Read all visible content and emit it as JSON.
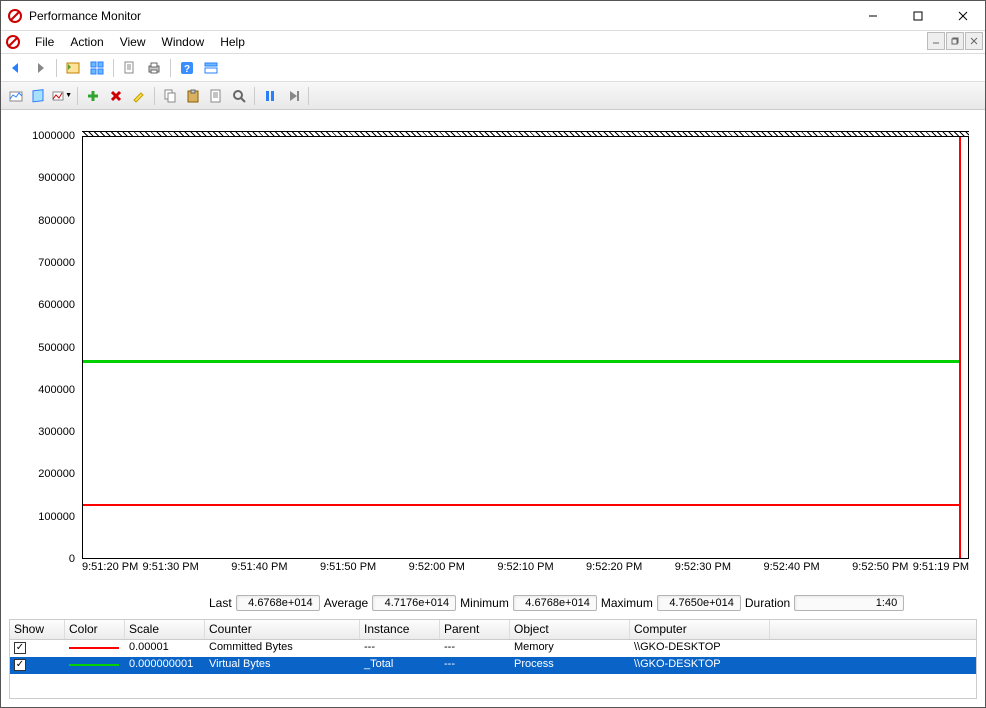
{
  "window": {
    "title": "Performance Monitor"
  },
  "menu": {
    "file": "File",
    "action": "Action",
    "view": "View",
    "window": "Window",
    "help": "Help"
  },
  "chart_data": {
    "type": "line",
    "title": "",
    "xlabel": "",
    "ylabel": "",
    "ylim": [
      0,
      1000000
    ],
    "yticks": [
      0,
      100000,
      200000,
      300000,
      400000,
      500000,
      600000,
      700000,
      800000,
      900000,
      1000000
    ],
    "xticks": [
      "9:51:20 PM",
      "9:51:30 PM",
      "9:51:40 PM",
      "9:51:50 PM",
      "9:52:00 PM",
      "9:52:10 PM",
      "9:52:20 PM",
      "9:52:30 PM",
      "9:52:40 PM",
      "9:52:50 PM",
      "9:51:19 PM"
    ],
    "series": [
      {
        "name": "Committed Bytes",
        "color": "#ff0000",
        "approx_value": 128000
      },
      {
        "name": "Virtual Bytes",
        "color": "#00d000",
        "approx_value": 470000
      }
    ],
    "marker_x_fraction": 0.99
  },
  "stats": {
    "last_label": "Last",
    "last": "4.6768e+014",
    "avg_label": "Average",
    "avg": "4.7176e+014",
    "min_label": "Minimum",
    "min": "4.6768e+014",
    "max_label": "Maximum",
    "max": "4.7650e+014",
    "dur_label": "Duration",
    "dur": "1:40"
  },
  "grid": {
    "headers": {
      "show": "Show",
      "color": "Color",
      "scale": "Scale",
      "counter": "Counter",
      "instance": "Instance",
      "parent": "Parent",
      "object": "Object",
      "computer": "Computer"
    },
    "rows": [
      {
        "checked": true,
        "color": "#ff0000",
        "scale": "0.00001",
        "counter": "Committed Bytes",
        "instance": "---",
        "parent": "---",
        "object": "Memory",
        "computer": "\\\\GKO-DESKTOP",
        "selected": false
      },
      {
        "checked": true,
        "color": "#00d000",
        "scale": "0.000000001",
        "counter": "Virtual Bytes",
        "instance": "_Total",
        "parent": "---",
        "object": "Process",
        "computer": "\\\\GKO-DESKTOP",
        "selected": true
      }
    ]
  }
}
